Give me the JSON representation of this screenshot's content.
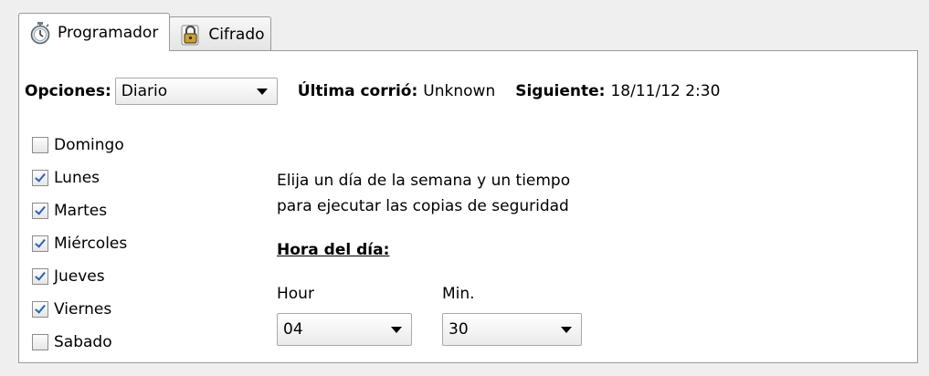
{
  "tabs": [
    {
      "label": "Programador",
      "icon": "stopwatch-icon",
      "active": true
    },
    {
      "label": "Cifrado",
      "icon": "lock-icon",
      "active": false
    }
  ],
  "options": {
    "label": "Opciones:",
    "value": "Diario",
    "last_run_label": "Última corrió:",
    "last_run_value": "Unknown",
    "next_label": "Siguiente:",
    "next_value": "18/11/12 2:30"
  },
  "days": [
    {
      "label": "Domingo",
      "checked": false
    },
    {
      "label": "Lunes",
      "checked": true
    },
    {
      "label": "Martes",
      "checked": true
    },
    {
      "label": "Miércoles",
      "checked": true
    },
    {
      "label": "Jueves",
      "checked": true
    },
    {
      "label": "Viernes",
      "checked": true
    },
    {
      "label": "Sabado",
      "checked": false
    }
  ],
  "description": {
    "line1": "Elija un día de la semana y un tiempo",
    "line2": "para ejecutar las copias de seguridad"
  },
  "time": {
    "heading": "Hora del día:",
    "hour_label": "Hour",
    "hour_value": "04",
    "min_label": "Min.",
    "min_value": "30"
  },
  "colors": {
    "check_accent": "#2a63b8",
    "panel_bg": "#ffffff",
    "window_bg": "#efefef"
  }
}
